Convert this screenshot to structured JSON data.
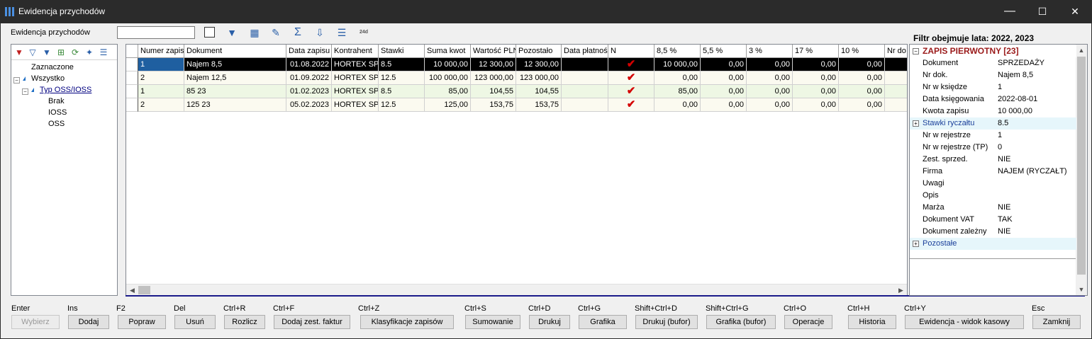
{
  "window": {
    "title": "Ewidencja przychodów",
    "minimize": "—",
    "maximize": "☐",
    "close": "✕"
  },
  "toolbar": {
    "label": "Ewidencja przychodów",
    "search_value": "",
    "icon_24d": "24d"
  },
  "filter_header": "Filtr obejmuje lata: 2022, 2023",
  "tree": {
    "items": [
      {
        "label": "Zaznaczone"
      },
      {
        "label": "Wszystko"
      },
      {
        "label": "Typ OSS/IOSS"
      },
      {
        "label": "Brak"
      },
      {
        "label": "IOSS"
      },
      {
        "label": "OSS"
      }
    ]
  },
  "grid": {
    "columns": [
      "",
      "Numer zapisu",
      "Dokument",
      "Data zapisu",
      "Kontrahent",
      "Stawki",
      "Suma kwot",
      "Wartość PLN",
      "Pozostało",
      "Data płatności",
      "N",
      "8,5 %",
      "5,5 %",
      "3 %",
      "17 %",
      "10 %",
      "Nr do"
    ],
    "rows": [
      [
        "",
        "1",
        "Najem 8,5",
        "01.08.2022",
        "HORTEX SPÓŁ",
        "8.5",
        "10 000,00",
        "12 300,00",
        "12 300,00",
        "",
        "✔",
        "10 000,00",
        "0,00",
        "0,00",
        "0,00",
        "0,00",
        ""
      ],
      [
        "",
        "2",
        "Najem 12,5",
        "01.09.2022",
        "HORTEX SPÓŁ",
        "12.5",
        "100 000,00",
        "123 000,00",
        "123 000,00",
        "",
        "✔",
        "0,00",
        "0,00",
        "0,00",
        "0,00",
        "0,00",
        ""
      ],
      [
        "",
        "1",
        "85 23",
        "01.02.2023",
        "HORTEX SPÓŁ",
        "8.5",
        "85,00",
        "104,55",
        "104,55",
        "",
        "✔",
        "85,00",
        "0,00",
        "0,00",
        "0,00",
        "0,00",
        ""
      ],
      [
        "",
        "2",
        "125 23",
        "05.02.2023",
        "HORTEX SPÓŁ",
        "12.5",
        "125,00",
        "153,75",
        "153,75",
        "",
        "✔",
        "0,00",
        "0,00",
        "0,00",
        "0,00",
        "0,00",
        ""
      ]
    ]
  },
  "props": {
    "header": "ZAPIS PIERWOTNY [23]",
    "rows": [
      {
        "k": "Dokument",
        "v": "SPRZEDAŻY"
      },
      {
        "k": "Nr dok.",
        "v": "Najem 8,5"
      },
      {
        "k": "Nr w księdze",
        "v": "1"
      },
      {
        "k": "Data księgowania",
        "v": "2022-08-01"
      },
      {
        "k": "Kwota zapisu",
        "v": " 10 000,00"
      },
      {
        "k": "Stawki ryczałtu",
        "v": "8.5"
      },
      {
        "k": "Nr w rejestrze",
        "v": "1"
      },
      {
        "k": "Nr w rejestrze (TP)",
        "v": "0"
      },
      {
        "k": "Zest. sprzed.",
        "v": "NIE"
      },
      {
        "k": "Firma",
        "v": "NAJEM (RYCZAŁT)"
      },
      {
        "k": "Uwagi",
        "v": ""
      },
      {
        "k": "Opis",
        "v": ""
      },
      {
        "k": "Marża",
        "v": "NIE"
      },
      {
        "k": "Dokument VAT",
        "v": "TAK"
      },
      {
        "k": "Dokument zależny",
        "v": "NIE"
      },
      {
        "k": "Pozostałe",
        "v": ""
      }
    ]
  },
  "buttons": [
    {
      "key": "Enter",
      "label": "Wybierz"
    },
    {
      "key": "Ins",
      "label": "Dodaj"
    },
    {
      "key": "F2",
      "label": "Popraw"
    },
    {
      "key": "Del",
      "label": "Usuń"
    },
    {
      "key": "Ctrl+R",
      "label": "Rozlicz"
    },
    {
      "key": "Ctrl+F",
      "label": "Dodaj zest. faktur"
    },
    {
      "key": "Ctrl+Z",
      "label": "Klasyfikacje zapisów"
    },
    {
      "key": "Ctrl+S",
      "label": "Sumowanie"
    },
    {
      "key": "Ctrl+D",
      "label": "Drukuj"
    },
    {
      "key": "Ctrl+G",
      "label": "Grafika"
    },
    {
      "key": "Shift+Ctrl+D",
      "label": "Drukuj (bufor)"
    },
    {
      "key": "Shift+Ctrl+G",
      "label": "Grafika (bufor)"
    },
    {
      "key": "Ctrl+O",
      "label": "Operacje"
    },
    {
      "key": "Ctrl+H",
      "label": "Historia"
    },
    {
      "key": "Ctrl+Y",
      "label": "Ewidencja  - widok kasowy"
    },
    {
      "key": "Esc",
      "label": "Zamknij"
    }
  ],
  "colors": {
    "selected_row": "#000000",
    "alt_row": "#eef7e4",
    "odd_row": "#fbfaf0",
    "blue_accent": "#1a1a8a"
  }
}
